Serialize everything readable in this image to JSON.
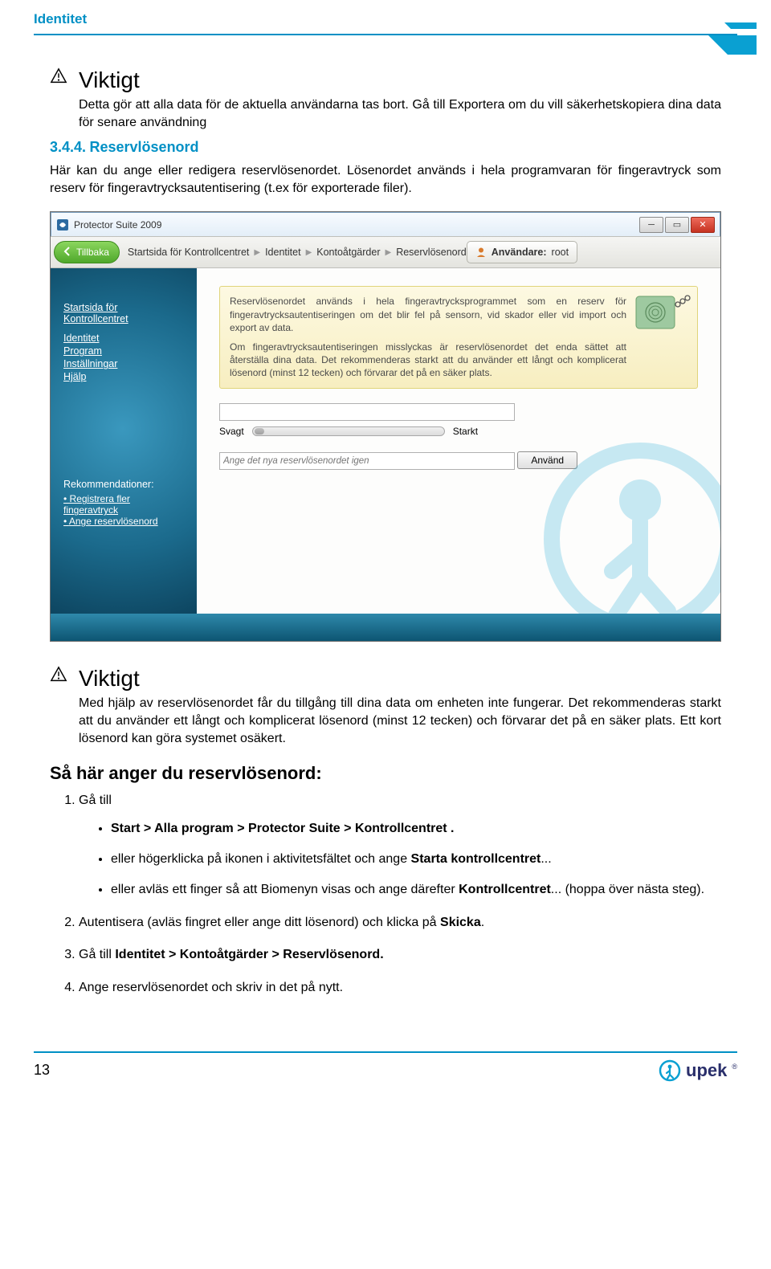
{
  "header": {
    "title": "Identitet"
  },
  "warning1": {
    "title": "Viktigt",
    "text": "Detta gör att alla data för de aktuella användarna tas bort. Gå till Exportera om du vill säkerhetskopiera dina data för senare användning"
  },
  "section": {
    "number": "3.4.4.",
    "title": "Reservlösenord",
    "text": "Här kan du ange eller redigera reservlösenordet. Lösenordet används i hela programvaran för fingeravtryck som reserv för fingeravtrycksautentisering (t.ex för exporterade filer)."
  },
  "screenshot": {
    "appTitle": "Protector Suite 2009",
    "back": "Tillbaka",
    "crumb1": "Startsida för Kontrollcentret",
    "crumb2": "Identitet",
    "crumb3": "Kontoåtgärder",
    "crumb4": "Reservlösenord",
    "userLabel": "Användare:",
    "userName": "root",
    "sidebar": {
      "title": "Startsida för Kontrollcentret",
      "items": [
        "Identitet",
        "Program",
        "Inställningar",
        "Hjälp"
      ],
      "recTitle": "Rekommendationer:",
      "recItems": [
        "Registrera fler fingeravtryck",
        "Ange reservlösenord"
      ]
    },
    "infoBox": {
      "p1": "Reservlösenordet används i hela fingeravtrycksprogrammet som en reserv för fingeravtrycksautentiseringen om det blir fel på sensorn, vid skador eller vid import och export av data.",
      "p2": "Om fingeravtrycksautentiseringen misslyckas är reservlösenordet det enda sättet att återställa dina data. Det rekommenderas starkt att du använder ett långt och komplicerat lösenord (minst 12 tecken) och förvarar det på en säker plats."
    },
    "weak": "Svagt",
    "strong": "Starkt",
    "repeatPlaceholder": "Ange det nya reservlösenordet igen",
    "apply": "Använd"
  },
  "warning2": {
    "title": "Viktigt",
    "text": "Med hjälp av reservlösenordet får du tillgång till dina data om enheten inte fungerar. Det rekommenderas starkt att du använder ett långt och komplicerat lösenord (minst 12 tecken) och förvarar det på en säker plats. Ett kort lösenord kan göra systemet osäkert."
  },
  "howto": {
    "heading": "Så här anger du reservlösenord:",
    "step1": "Gå till",
    "b1a": "Start > Alla program > Protector Suite > Kontrollcentret .",
    "b1b_pre": "eller högerklicka på ikonen i aktivitetsfältet och ange ",
    "b1b_bold": "Starta kontrollcentret",
    "b1b_post": "...",
    "b1c_pre": "eller avläs ett finger så att Biomenyn visas och ange därefter ",
    "b1c_bold": "Kontrollcentret",
    "b1c_post": "... (hoppa över nästa steg).",
    "step2_pre": "Autentisera (avläs fingret eller ange ditt lösenord) och klicka på ",
    "step2_bold": "Skicka",
    "step2_post": ".",
    "step3_pre": "Gå till ",
    "step3_bold": "Identitet > Kontoåtgärder > Reservlösenord.",
    "step4": "Ange reservlösenordet och skriv in det på nytt."
  },
  "footer": {
    "pageNumber": "13",
    "logo": "upek"
  }
}
